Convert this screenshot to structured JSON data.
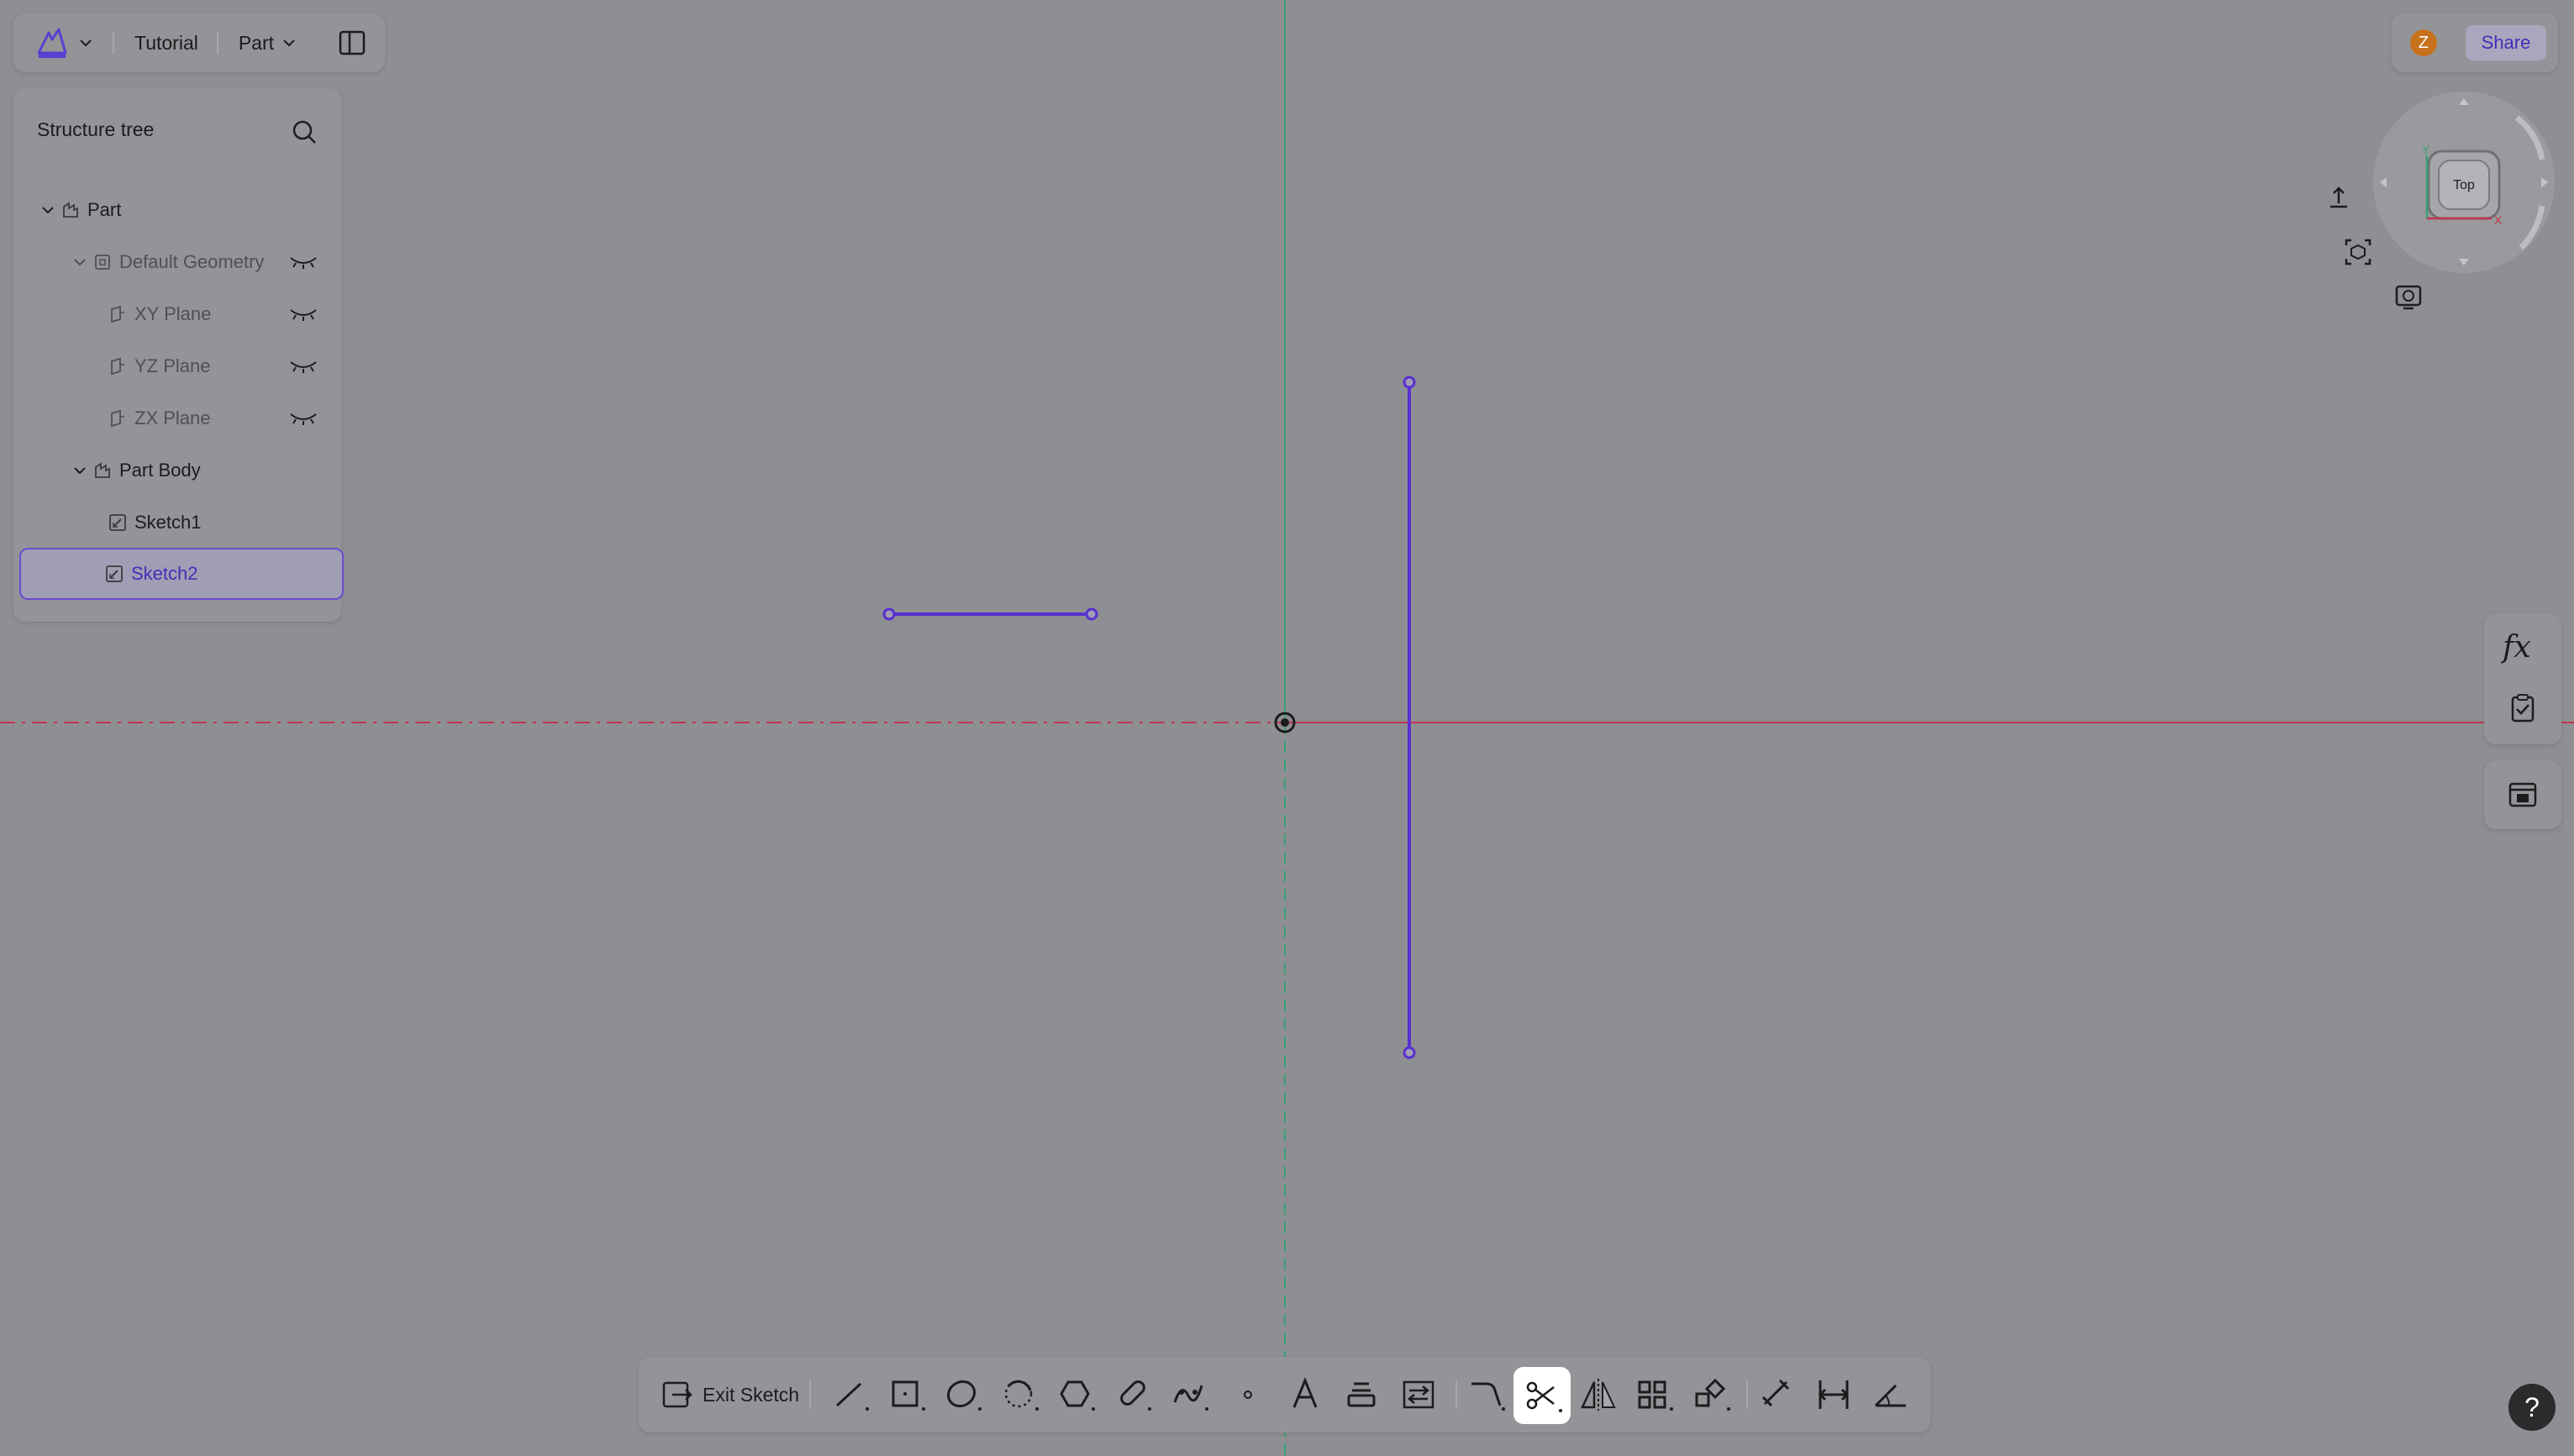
{
  "app": {
    "project_title": "Tutorial",
    "mode_dropdown": "Part",
    "user_initial": "Z",
    "share_label": "Share",
    "help_label": "?"
  },
  "tree": {
    "title": "Structure tree",
    "items": [
      {
        "label": "Part"
      },
      {
        "label": "Default Geometry"
      },
      {
        "label": "XY Plane"
      },
      {
        "label": "YZ Plane"
      },
      {
        "label": "ZX Plane"
      },
      {
        "label": "Part Body"
      },
      {
        "label": "Sketch1"
      },
      {
        "label": "Sketch2"
      }
    ],
    "selected": "Sketch2"
  },
  "navcube": {
    "face": "Top",
    "axis_y": "Y",
    "axis_x": "X"
  },
  "toolbar": {
    "exit_label": "Exit Sketch",
    "active_tool": "trim-tool"
  },
  "colors": {
    "accent": "#6a4bd1",
    "sketch_line": "#5a2fd0",
    "x_axis": "#c4344d",
    "y_axis": "#3aa07a",
    "canvas": "#8e8f92"
  }
}
